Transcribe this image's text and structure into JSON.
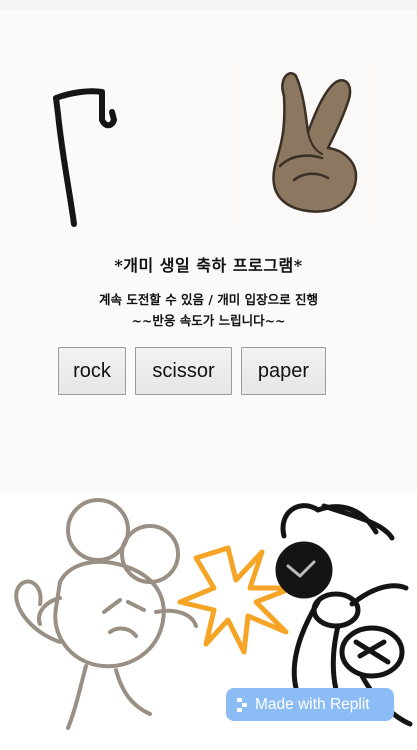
{
  "header": {
    "title": "*개미 생일 축하 프로그램*",
    "subtitle_line1": "계속 도전할 수 있음 / 개미 입장으로 진행",
    "subtitle_line2": "~~반응 속도가 느립니다~~"
  },
  "images": {
    "left": "cane-drawing",
    "right": "peace-hand-drawing",
    "bottom": "mouse-vs-ant-drawing"
  },
  "buttons": {
    "rock": "rock",
    "scissor": "scissor",
    "paper": "paper"
  },
  "badge": {
    "label": "Made with Replit",
    "icon": "replit-icon"
  },
  "colors": {
    "badge": "#8bbcf5",
    "hand": "#8c7760",
    "spark": "#f5a425"
  }
}
